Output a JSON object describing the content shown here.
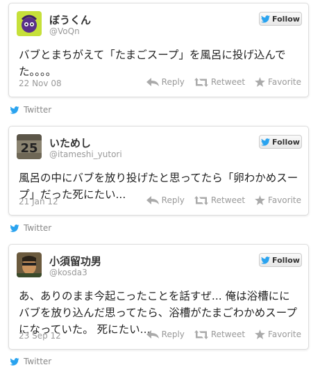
{
  "follow_label": "Follow",
  "actions": {
    "reply": "Reply",
    "retweet": "Retweet",
    "favorite": "Favorite"
  },
  "attribution": "Twitter",
  "tweets": [
    {
      "name": "ぼうくん",
      "handle": "@VoQn",
      "text": "バブとまちがえて「たまごスープ」を風呂に投げ込んでた。。。。",
      "date": "22 Nov 08"
    },
    {
      "name": "いためし",
      "handle": "@itameshi_yutori",
      "text": "風呂の中にバブを放り投げたと思ってたら「卵わかめスープ」だった死にたい...",
      "date": "21 Jan 12"
    },
    {
      "name": "小須留功男",
      "handle": "@kosda3",
      "text": "あ、ありのまま今起こったことを話すぜ... 俺は浴槽ににバブを放り込んだ思ってたら、浴槽がたまごわかめスープになっていた。 死にたい...",
      "date": "23 Sep 12"
    }
  ],
  "colors": {
    "twitter_blue": "#2aa3ef",
    "muted": "#999999",
    "border": "#dddddd"
  }
}
